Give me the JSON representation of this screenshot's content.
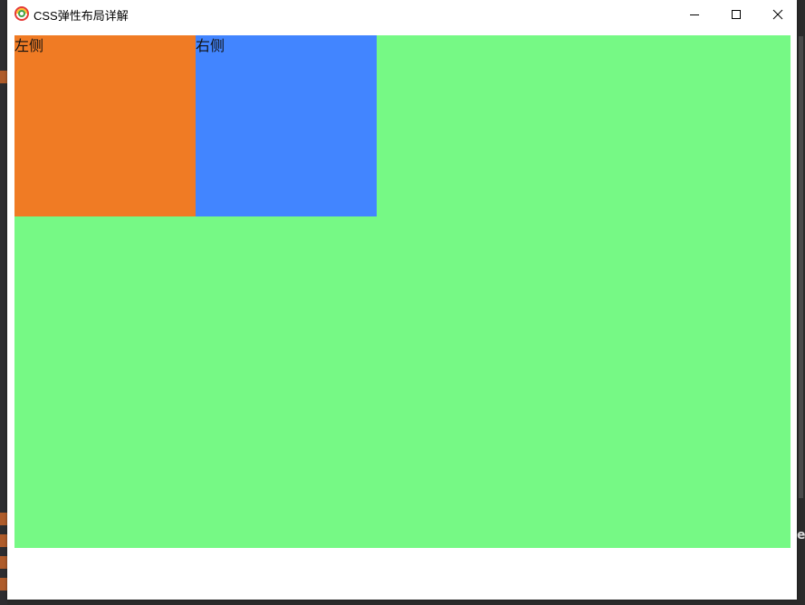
{
  "window": {
    "title": "CSS弹性布局详解"
  },
  "boxes": {
    "left_label": "左侧",
    "right_label": "右侧"
  },
  "colors": {
    "container": "#76f985",
    "left": "#f07b24",
    "right": "#4285ff"
  },
  "background_peek": {
    "right_char": "e"
  }
}
